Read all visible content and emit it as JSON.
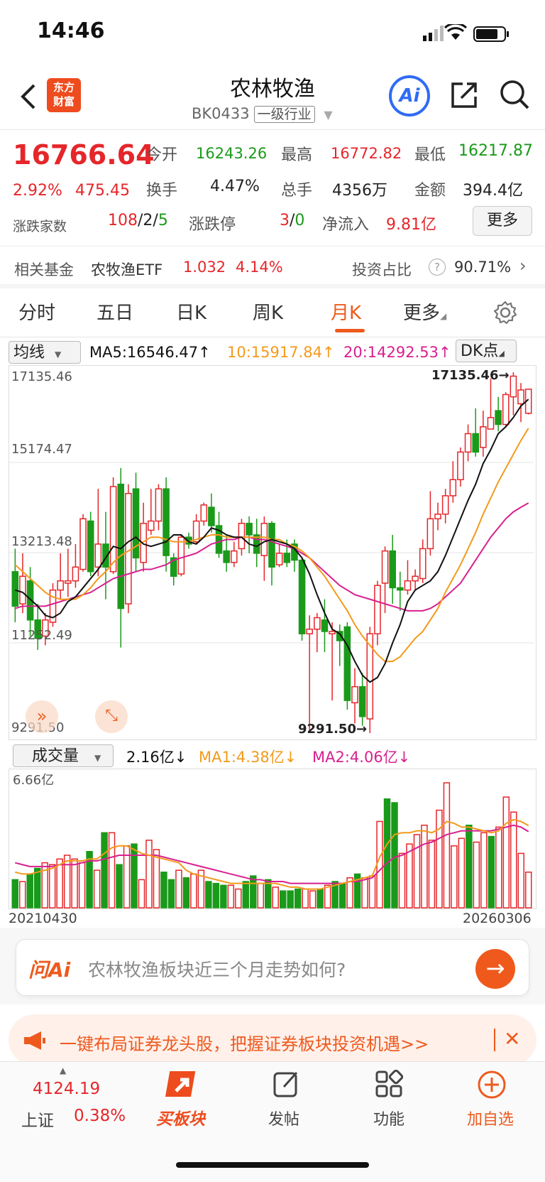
{
  "status": {
    "time": "14:46"
  },
  "header": {
    "back_icon": "chevron-left-icon",
    "logo_text_1": "东方",
    "logo_text_2": "财富",
    "title": "农林牧渔",
    "code": "BK0433",
    "tag": "一级行业",
    "ai_label": "Ai",
    "share_icon": "share-icon",
    "search_icon": "search-icon"
  },
  "quote": {
    "price": "16766.64",
    "change_pct": "2.92%",
    "change_val": "475.45",
    "open_label": "今开",
    "open": "16243.26",
    "high_label": "最高",
    "high": "16772.82",
    "low_label": "最低",
    "low": "16217.87",
    "turnover_label": "换手",
    "turnover": "4.47%",
    "volume_label": "总手",
    "volume": "4356万",
    "amount_label": "金额",
    "amount": "394.4亿",
    "updown_label": "涨跌家数",
    "up": "108",
    "flat": "2",
    "down": "5",
    "limit_label": "涨跌停",
    "limit_up": "3",
    "limit_down": "0",
    "inflow_label": "净流入",
    "inflow": "9.81亿",
    "more_label": "更多"
  },
  "fund": {
    "label": "相关基金",
    "name": "农牧渔ETF",
    "price": "1.032",
    "pct": "4.14%",
    "ratio_label": "投资占比",
    "ratio": "90.71%"
  },
  "tabs": [
    "分时",
    "五日",
    "日K",
    "周K",
    "月K",
    "更多"
  ],
  "active_tab": "月K",
  "ma": {
    "selector": "均线",
    "ma5": "MA5:16546.47↑",
    "ma10": "10:15917.84↑",
    "ma20": "20:14292.53↑",
    "dk": "DK点"
  },
  "axis": {
    "y_labels": [
      "17135.46",
      "15174.47",
      "13213.48",
      "11252.49",
      "9291.50"
    ],
    "max_marker": "17135.46→",
    "min_marker": "9291.50→",
    "vol_max": "6.66亿",
    "date_start": "20210430",
    "date_end": "20260306"
  },
  "volume": {
    "selector": "成交量",
    "current": "2.16亿↓",
    "ma1": "MA1:4.38亿↓",
    "ma2": "MA2:4.06亿↓"
  },
  "ask": {
    "logo": "问Ai",
    "text": "农林牧渔板块近三个月走势如何?"
  },
  "banner": {
    "text": "一键布局证券龙头股，把握证券板块投资机遇>>"
  },
  "bottom_nav": {
    "index_value": "4124.19",
    "index_name": "上证",
    "index_pct": "0.38%",
    "buy_label": "买板块",
    "post_label": "发帖",
    "func_label": "功能",
    "add_label": "加自选"
  },
  "colors": {
    "up": "#e5262a",
    "down": "#1a9a1a",
    "accent": "#ee5a1e",
    "ma5": "#111111",
    "ma10": "#f39a1b",
    "ma20": "#d8208f"
  },
  "chart_data": {
    "type": "candlestick",
    "ylim": [
      9291.5,
      17135.46
    ],
    "candles": [
      {
        "o": 12800,
        "c": 12050,
        "h": 13300,
        "l": 11700
      },
      {
        "o": 12100,
        "c": 12700,
        "h": 13200,
        "l": 11900
      },
      {
        "o": 12600,
        "c": 11750,
        "h": 12900,
        "l": 11400
      },
      {
        "o": 11750,
        "c": 11350,
        "h": 12100,
        "l": 11100
      },
      {
        "o": 11400,
        "c": 11750,
        "h": 11900,
        "l": 11200
      },
      {
        "o": 11700,
        "c": 12400,
        "h": 12550,
        "l": 11600
      },
      {
        "o": 12400,
        "c": 12600,
        "h": 13200,
        "l": 12200
      },
      {
        "o": 12550,
        "c": 12600,
        "h": 13300,
        "l": 12250
      },
      {
        "o": 12600,
        "c": 12900,
        "h": 13400,
        "l": 12450
      },
      {
        "o": 12850,
        "c": 13950,
        "h": 14050,
        "l": 12800
      },
      {
        "o": 13900,
        "c": 12800,
        "h": 14100,
        "l": 12700
      },
      {
        "o": 12900,
        "c": 13400,
        "h": 14600,
        "l": 12700
      },
      {
        "o": 13400,
        "c": 12900,
        "h": 14100,
        "l": 12200
      },
      {
        "o": 12800,
        "c": 14650,
        "h": 14850,
        "l": 12750
      },
      {
        "o": 14700,
        "c": 12000,
        "h": 15050,
        "l": 11150
      },
      {
        "o": 12100,
        "c": 14500,
        "h": 14700,
        "l": 11900
      },
      {
        "o": 14600,
        "c": 13100,
        "h": 14950,
        "l": 12800
      },
      {
        "o": 13000,
        "c": 13850,
        "h": 14300,
        "l": 12800
      },
      {
        "o": 13700,
        "c": 13900,
        "h": 14600,
        "l": 13600
      },
      {
        "o": 13900,
        "c": 14600,
        "h": 14700,
        "l": 13700
      },
      {
        "o": 14600,
        "c": 13150,
        "h": 14850,
        "l": 12800
      },
      {
        "o": 13100,
        "c": 12700,
        "h": 13200,
        "l": 12500
      },
      {
        "o": 12750,
        "c": 13550,
        "h": 13600,
        "l": 12700
      },
      {
        "o": 13550,
        "c": 13400,
        "h": 13650,
        "l": 13300
      },
      {
        "o": 13450,
        "c": 13900,
        "h": 14050,
        "l": 13400
      },
      {
        "o": 13900,
        "c": 14250,
        "h": 14300,
        "l": 13800
      },
      {
        "o": 14200,
        "c": 13800,
        "h": 14500,
        "l": 13650
      },
      {
        "o": 13800,
        "c": 13200,
        "h": 14100,
        "l": 13100
      },
      {
        "o": 13250,
        "c": 13000,
        "h": 13600,
        "l": 12800
      },
      {
        "o": 13000,
        "c": 13250,
        "h": 13450,
        "l": 12900
      },
      {
        "o": 13300,
        "c": 13850,
        "h": 13950,
        "l": 13150
      },
      {
        "o": 13850,
        "c": 13600,
        "h": 14000,
        "l": 13200
      },
      {
        "o": 13600,
        "c": 13200,
        "h": 13950,
        "l": 12900
      },
      {
        "o": 13150,
        "c": 13850,
        "h": 14000,
        "l": 12600
      },
      {
        "o": 13850,
        "c": 12900,
        "h": 13900,
        "l": 12500
      },
      {
        "o": 12950,
        "c": 13200,
        "h": 13400,
        "l": 12900
      },
      {
        "o": 13200,
        "c": 13000,
        "h": 13500,
        "l": 12900
      },
      {
        "o": 13400,
        "c": 13050,
        "h": 13500,
        "l": 12800
      },
      {
        "o": 13050,
        "c": 11450,
        "h": 13100,
        "l": 11300
      },
      {
        "o": 11450,
        "c": 11550,
        "h": 11850,
        "l": 9350
      },
      {
        "o": 11550,
        "c": 11800,
        "h": 11900,
        "l": 11050
      },
      {
        "o": 11750,
        "c": 11500,
        "h": 12200,
        "l": 11050
      },
      {
        "o": 11450,
        "c": 11500,
        "h": 11700,
        "l": 10000
      },
      {
        "o": 11500,
        "c": 11300,
        "h": 11650,
        "l": 10750
      },
      {
        "o": 11600,
        "c": 10000,
        "h": 11700,
        "l": 9800
      },
      {
        "o": 9950,
        "c": 10300,
        "h": 10700,
        "l": 9500
      },
      {
        "o": 10300,
        "c": 9650,
        "h": 10600,
        "l": 9450
      },
      {
        "o": 9600,
        "c": 11450,
        "h": 11600,
        "l": 9291
      },
      {
        "o": 11450,
        "c": 12500,
        "h": 12600,
        "l": 11200
      },
      {
        "o": 12550,
        "c": 13250,
        "h": 13350,
        "l": 11900
      },
      {
        "o": 13250,
        "c": 12450,
        "h": 13600,
        "l": 12100
      },
      {
        "o": 12450,
        "c": 12400,
        "h": 12800,
        "l": 11950
      },
      {
        "o": 12400,
        "c": 12600,
        "h": 13050,
        "l": 12300
      },
      {
        "o": 12600,
        "c": 12700,
        "h": 12850,
        "l": 12400
      },
      {
        "o": 12650,
        "c": 13300,
        "h": 13500,
        "l": 12550
      },
      {
        "o": 13300,
        "c": 13950,
        "h": 14550,
        "l": 13150
      },
      {
        "o": 13950,
        "c": 14050,
        "h": 14300,
        "l": 13700
      },
      {
        "o": 14050,
        "c": 14450,
        "h": 14600,
        "l": 13850
      },
      {
        "o": 14450,
        "c": 14800,
        "h": 15200,
        "l": 14300
      },
      {
        "o": 14800,
        "c": 15400,
        "h": 15500,
        "l": 14650
      },
      {
        "o": 15400,
        "c": 15800,
        "h": 16000,
        "l": 15200
      },
      {
        "o": 15800,
        "c": 15400,
        "h": 16350,
        "l": 15300
      },
      {
        "o": 15500,
        "c": 15950,
        "h": 16300,
        "l": 15300
      },
      {
        "o": 15900,
        "c": 16150,
        "h": 17000,
        "l": 15900
      },
      {
        "o": 16300,
        "c": 16000,
        "h": 16600,
        "l": 15850
      },
      {
        "o": 16000,
        "c": 16650,
        "h": 16700,
        "l": 15950
      },
      {
        "o": 16600,
        "c": 17050,
        "h": 17135,
        "l": 16200
      },
      {
        "o": 16450,
        "c": 16750,
        "h": 16900,
        "l": 16050
      },
      {
        "o": 16243,
        "c": 16767,
        "h": 16773,
        "l": 16218
      }
    ],
    "ma5": [
      12400,
      12350,
      12200,
      12050,
      11850,
      11800,
      11900,
      12150,
      12250,
      12450,
      12650,
      12850,
      13100,
      13350,
      13300,
      13450,
      13550,
      13400,
      13350,
      13400,
      13450,
      13600,
      13600,
      13450,
      13400,
      13550,
      13750,
      13700,
      13600,
      13550,
      13550,
      13400,
      13350,
      13450,
      13500,
      13450,
      13400,
      13300,
      13100,
      12750,
      12300,
      11900,
      11550,
      11450,
      11200,
      10850,
      10550,
      10400,
      10500,
      10800,
      11250,
      11650,
      12150,
      12400,
      12500,
      12600,
      12800,
      13150,
      13550,
      13950,
      14350,
      14700,
      15150,
      15450,
      15800,
      15950,
      16150,
      16400,
      16546
    ],
    "ma10": [
      12950,
      12800,
      12650,
      12500,
      12350,
      12250,
      12200,
      12200,
      12200,
      12300,
      12450,
      12650,
      12800,
      13000,
      13150,
      13250,
      13350,
      13450,
      13550,
      13550,
      13500,
      13450,
      13450,
      13450,
      13500,
      13550,
      13600,
      13600,
      13550,
      13550,
      13550,
      13550,
      13550,
      13550,
      13500,
      13500,
      13400,
      13350,
      13250,
      13100,
      12900,
      12700,
      12450,
      12200,
      11950,
      11650,
      11400,
      11200,
      11000,
      10850,
      10850,
      10950,
      11150,
      11350,
      11500,
      11750,
      12000,
      12350,
      12650,
      12950,
      13300,
      13650,
      14050,
      14400,
      14750,
      15050,
      15350,
      15650,
      15918
    ],
    "ma20": [
      12000,
      12050,
      12050,
      12050,
      12050,
      12100,
      12150,
      12200,
      12250,
      12300,
      12350,
      12450,
      12550,
      12650,
      12700,
      12750,
      12800,
      12850,
      12850,
      12900,
      12950,
      13050,
      13100,
      13150,
      13200,
      13300,
      13400,
      13450,
      13500,
      13500,
      13550,
      13550,
      13500,
      13500,
      13450,
      13400,
      13350,
      13300,
      13200,
      13100,
      12950,
      12800,
      12650,
      12500,
      12400,
      12300,
      12250,
      12200,
      12150,
      12100,
      12050,
      12000,
      11950,
      11950,
      11950,
      12000,
      12100,
      12250,
      12400,
      12550,
      12800,
      13050,
      13300,
      13550,
      13750,
      13950,
      14100,
      14200,
      14293
    ],
    "volumes": [
      1.5,
      1.4,
      1.8,
      2.1,
      2.4,
      2.3,
      2.6,
      2.8,
      2.6,
      2.4,
      3.0,
      2.0,
      4.0,
      4.0,
      2.3,
      3.3,
      3.4,
      1.5,
      3.6,
      3.1,
      1.9,
      1.5,
      2.0,
      1.6,
      1.8,
      2.0,
      1.4,
      1.3,
      1.2,
      1.2,
      1.0,
      1.4,
      1.7,
      1.3,
      1.5,
      1.1,
      0.9,
      0.9,
      1.0,
      1.0,
      0.9,
      1.0,
      1.2,
      1.4,
      1.3,
      1.6,
      1.8,
      1.6,
      1.7,
      4.6,
      5.8,
      5.6,
      2.9,
      3.4,
      3.9,
      4.4,
      3.6,
      5.2,
      6.66,
      3.3,
      3.7,
      4.4,
      3.5,
      4.0,
      3.8,
      4.3,
      5.9,
      5.1,
      2.9,
      1.9
    ],
    "vol_ma1": [
      1.9,
      1.8,
      1.8,
      1.9,
      2.0,
      2.1,
      2.3,
      2.5,
      2.5,
      2.5,
      2.6,
      2.6,
      2.9,
      3.2,
      3.3,
      3.3,
      3.1,
      2.9,
      2.8,
      2.7,
      2.6,
      2.5,
      2.4,
      2.0,
      1.8,
      1.7,
      1.6,
      1.5,
      1.4,
      1.3,
      1.3,
      1.3,
      1.3,
      1.3,
      1.3,
      1.3,
      1.2,
      1.1,
      1.1,
      1.0,
      1.0,
      1.0,
      1.1,
      1.2,
      1.3,
      1.4,
      1.5,
      1.6,
      1.7,
      2.7,
      3.4,
      3.9,
      4.0,
      4.0,
      4.1,
      4.1,
      4.0,
      4.2,
      4.6,
      4.5,
      4.3,
      4.3,
      4.2,
      4.1,
      4.0,
      4.1,
      4.5,
      4.7,
      4.6,
      4.38
    ],
    "vol_ma2": [
      2.4,
      2.3,
      2.2,
      2.2,
      2.2,
      2.2,
      2.3,
      2.3,
      2.3,
      2.4,
      2.5,
      2.5,
      2.6,
      2.7,
      2.8,
      2.8,
      2.8,
      2.8,
      2.8,
      2.8,
      2.7,
      2.6,
      2.5,
      2.4,
      2.3,
      2.2,
      2.1,
      2.0,
      1.9,
      1.8,
      1.7,
      1.6,
      1.5,
      1.5,
      1.4,
      1.4,
      1.4,
      1.3,
      1.3,
      1.3,
      1.3,
      1.3,
      1.3,
      1.3,
      1.3,
      1.4,
      1.4,
      1.5,
      1.6,
      2.0,
      2.4,
      2.7,
      2.8,
      3.0,
      3.2,
      3.4,
      3.5,
      3.7,
      3.9,
      4.0,
      4.1,
      4.1,
      4.1,
      4.1,
      4.1,
      4.2,
      4.3,
      4.4,
      4.3,
      4.06
    ]
  }
}
